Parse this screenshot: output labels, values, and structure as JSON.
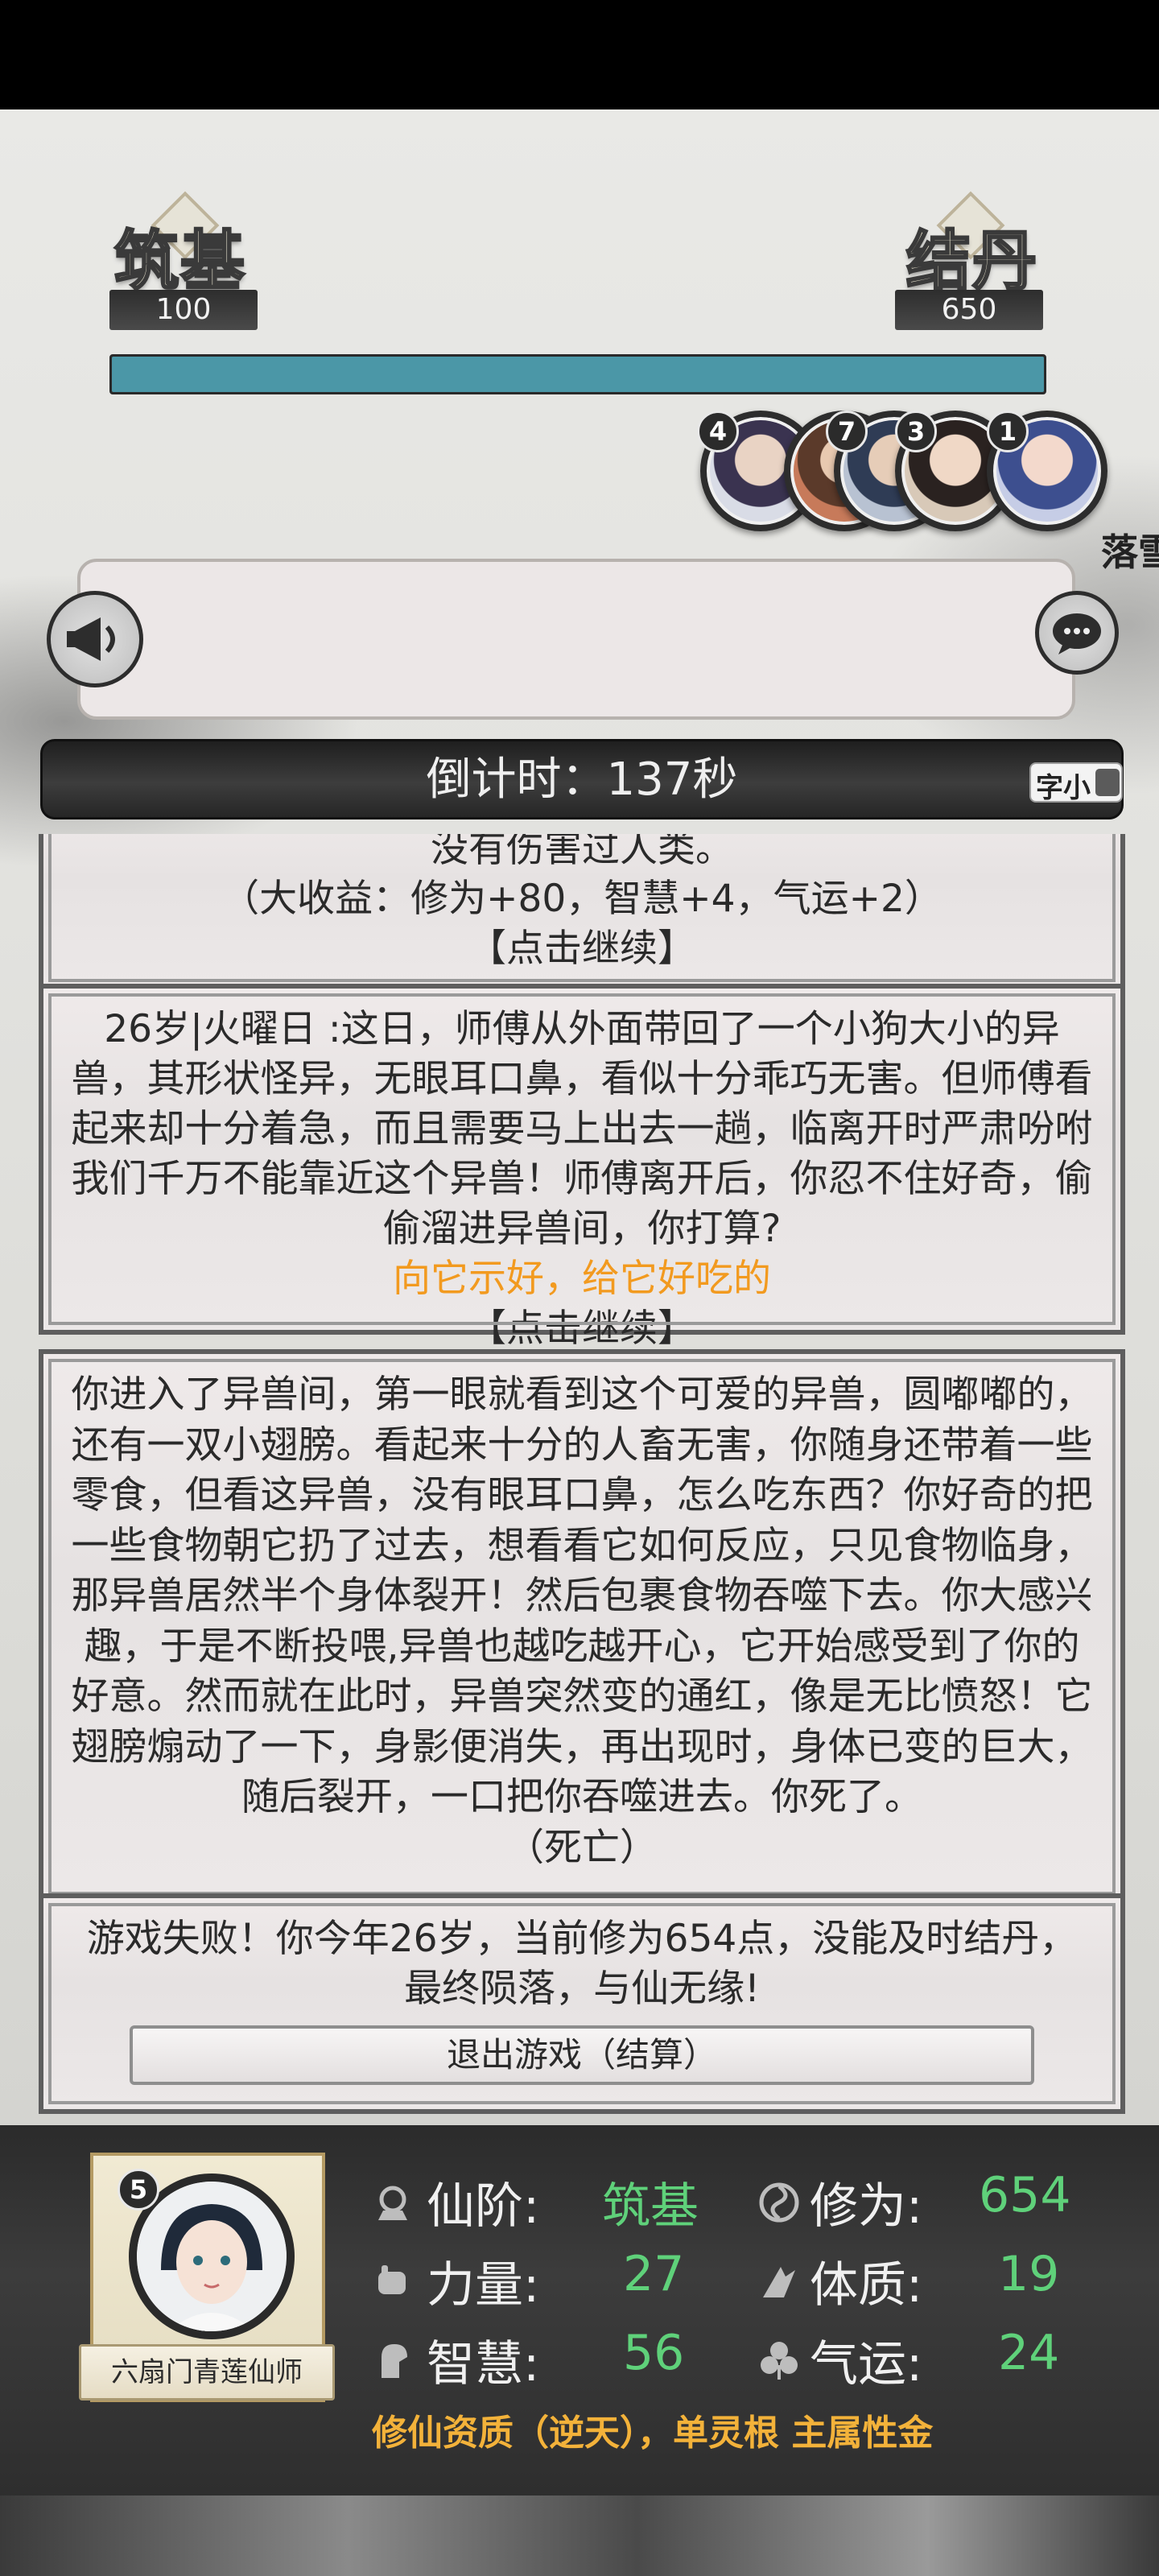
{
  "header": {
    "current_realm": {
      "name": "筑基",
      "score": "100"
    },
    "next_realm": {
      "name": "结丹",
      "score": "650"
    },
    "progress_fraction": 1.0
  },
  "avatars": [
    {
      "badge": "4"
    },
    {
      "badge": "7"
    },
    {
      "badge": "3"
    },
    {
      "badge": "1"
    }
  ],
  "side_label": "落雪",
  "announcement": {
    "text": ""
  },
  "countdown": {
    "label": "倒计时：137秒",
    "toggle_label": "字小"
  },
  "log": [
    {
      "lines": [
        "没有伤害过人类。",
        "（大收益：修为+80，智慧+4，气运+2）"
      ],
      "continue": "【点击继续】"
    },
    {
      "text": "26岁|火曜日 :这日，师傅从外面带回了一个小狗大小的异兽，其形状怪异，无眼耳口鼻，看似十分乖巧无害。但师傅看起来却十分着急，而且需要马上出去一趟，临离开时严肃吩咐我们千万不能靠近这个异兽！师傅离开后，你忍不住好奇，偷偷溜进异兽间，你打算?",
      "choice": "向它示好，给它好吃的",
      "continue": "【点击继续】"
    },
    {
      "text": "你进入了异兽间，第一眼就看到这个可爱的异兽，圆嘟嘟的，还有一双小翅膀。看起来十分的人畜无害，你随身还带着一些零食，但看这异兽，没有眼耳口鼻，怎么吃东西？你好奇的把一些食物朝它扔了过去，想看看它如何反应，只见食物临身，那异兽居然半个身体裂开！然后包裹食物吞噬下去。你大感兴趣，于是不断投喂,异兽也越吃越开心，它开始感受到了你的好意。然而就在此时，异兽突然变的通红，像是无比愤怒！它翅膀煽动了一下，身影便消失，再出现时，身体已变的巨大，随后裂开，一口把你吞噬进去。你死了。",
      "result": "（死亡）"
    },
    {
      "text": "游戏失败！你今年26岁，当前修为654点，没能及时结丹，最终陨落，与仙无缘!",
      "button": "退出游戏（结算）"
    }
  ],
  "character": {
    "level_badge": "5",
    "name": "六扇门青莲仙师",
    "stats": [
      {
        "icon": "realm-icon",
        "label": "仙阶:",
        "value": "筑基"
      },
      {
        "icon": "cultivation-icon",
        "label": "修为:",
        "value": "654"
      },
      {
        "icon": "strength-icon",
        "label": "力量:",
        "value": "27"
      },
      {
        "icon": "constitution-icon",
        "label": "体质:",
        "value": "19"
      },
      {
        "icon": "wisdom-icon",
        "label": "智慧:",
        "value": "56"
      },
      {
        "icon": "luck-icon",
        "label": "气运:",
        "value": "24"
      }
    ],
    "aptitude": "修仙资质（逆天），单灵根 主属性金"
  },
  "colors": {
    "progress": "#4b97a7",
    "choice": "#f29a1f",
    "stat_value": "#5fd17a",
    "aptitude": "#f3b23a"
  }
}
